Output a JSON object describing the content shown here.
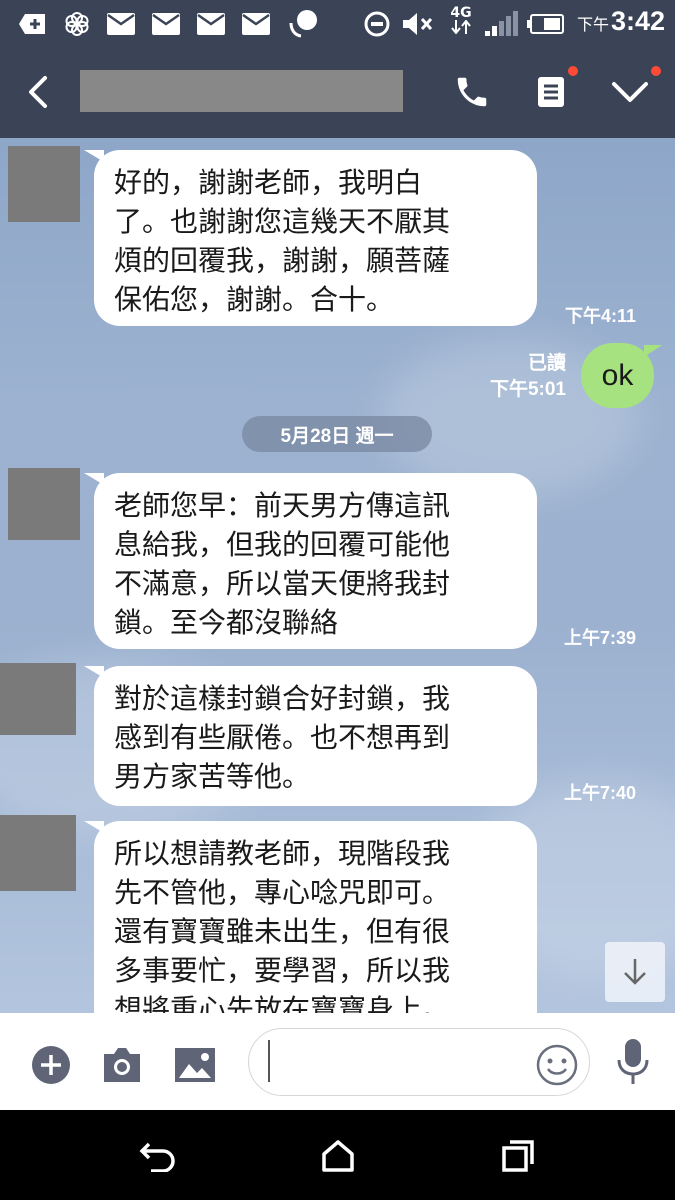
{
  "status_bar": {
    "network": "4G",
    "time_ampm": "下午",
    "time": "3:42",
    "icons": [
      "plus-box-icon",
      "flower-icon",
      "mail-icon",
      "mail-icon",
      "mail-icon",
      "mail-icon",
      "messenger-icon",
      "do-not-disturb-icon",
      "mute-icon",
      "signal-icon",
      "battery-icon"
    ]
  },
  "header": {
    "back_icon": "chevron-left-icon",
    "contact_name": "",
    "call_icon": "phone-icon",
    "notes_icon": "notes-icon",
    "menu_icon": "chevron-down-icon",
    "badge_color": "#ff4a36"
  },
  "messages": [
    {
      "id": "m1",
      "direction": "in",
      "text": "好的，謝謝老師，我明白\n了。也謝謝您這幾天不厭其\n煩的回覆我，謝謝，願菩薩\n保佑您，謝謝。合十。",
      "time": "下午4:11"
    },
    {
      "id": "m2",
      "direction": "out",
      "text": "ok",
      "read": "已讀",
      "time": "下午5:01"
    },
    {
      "id": "m3",
      "direction": "in",
      "text": "老師您早：前天男方傳這訊\n息給我，但我的回覆可能他\n不滿意，所以當天便將我封\n鎖。至今都沒聯絡",
      "time": "上午7:39"
    },
    {
      "id": "m4",
      "direction": "in",
      "text": "對於這樣封鎖合好封鎖，我\n感到有些厭倦。也不想再到\n男方家苦等他。",
      "time": "上午7:40"
    },
    {
      "id": "m5",
      "direction": "in",
      "text": "所以想請教老師，現階段我\n先不管他，專心唸咒即可。\n還有寶寶雖未出生，但有很\n多事要忙，要學習，所以我\n想將重心先放在寶寶身上。"
    }
  ],
  "date_divider": "5月28日 週一",
  "input_bar": {
    "placeholder": "",
    "icons": [
      "add-circle-icon",
      "camera-icon",
      "image-icon",
      "emoji-icon",
      "microphone-icon"
    ]
  },
  "colors": {
    "header": "#3b4457",
    "outgoing_bubble": "#a6e27f",
    "incoming_bubble": "#ffffff"
  }
}
